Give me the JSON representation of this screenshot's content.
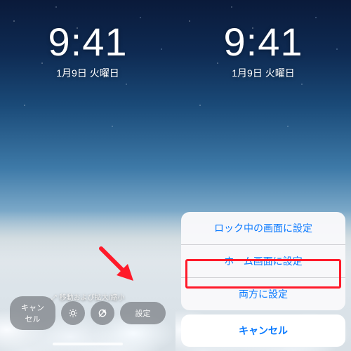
{
  "clock": {
    "time": "9:41",
    "date": "1月9日 火曜日"
  },
  "left": {
    "move_label": "移動および拡大/縮小",
    "cancel": "キャンセル",
    "set": "設定"
  },
  "sheet": {
    "lock": "ロック中の画面に設定",
    "home": "ホーム画面に設定",
    "both": "両方に設定",
    "cancel": "キャンセル"
  }
}
